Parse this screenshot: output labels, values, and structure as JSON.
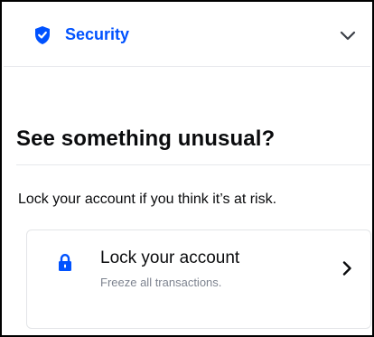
{
  "header": {
    "title": "Security",
    "icon": "shield-icon",
    "toggle_icon": "chevron-down-icon",
    "accent_color": "#0052ff"
  },
  "main": {
    "title": "See something unusual?",
    "subtitle": "Lock your account if you think it’s at risk.",
    "card": {
      "icon": "lock-icon",
      "title": "Lock your account",
      "description": "Freeze all transactions.",
      "action_icon": "chevron-right-icon"
    }
  }
}
